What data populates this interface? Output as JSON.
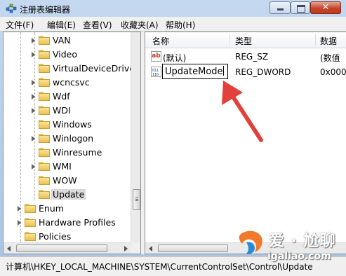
{
  "window": {
    "title": "注册表编辑器",
    "close_glyph": "✕"
  },
  "menu": [
    "文件(F)",
    "编辑(E)",
    "查看(V)",
    "收藏夹(A)",
    "帮助(H)"
  ],
  "tree": {
    "items": [
      {
        "label": "VAN",
        "expandable": true
      },
      {
        "label": "Video",
        "expandable": true
      },
      {
        "label": "VirtualDeviceDriver",
        "expandable": false
      },
      {
        "label": "wcncsvc",
        "expandable": true
      },
      {
        "label": "Wdf",
        "expandable": true
      },
      {
        "label": "WDI",
        "expandable": true
      },
      {
        "label": "Windows",
        "expandable": false
      },
      {
        "label": "Winlogon",
        "expandable": true
      },
      {
        "label": "Winresume",
        "expandable": false
      },
      {
        "label": "WMI",
        "expandable": true
      },
      {
        "label": "WOW",
        "expandable": false
      },
      {
        "label": "Update",
        "expandable": false,
        "selected": true
      },
      {
        "label": "Enum",
        "expandable": true
      },
      {
        "label": "Hardware Profiles",
        "expandable": true
      },
      {
        "label": "Policies",
        "expandable": false
      }
    ]
  },
  "list": {
    "columns": [
      "名称",
      "类型",
      "数据"
    ],
    "rows": [
      {
        "name": "(默认)",
        "type": "REG_SZ",
        "data": "(数值",
        "icon": "string-value-icon"
      },
      {
        "name": "UpdateMode",
        "type": "REG_DWORD",
        "data": "0x000",
        "icon": "dword-value-icon",
        "editing": true
      }
    ],
    "ab_text": "ab",
    "dword_text": "011\n110"
  },
  "status": {
    "path": "计算机\\HKEY_LOCAL_MACHINE\\SYSTEM\\CurrentControlSet\\Control\\Update"
  },
  "watermark": {
    "top": "爱 · 尬聊",
    "bottom": "igaliao.com"
  },
  "colors": {
    "arrow": "#e2413b",
    "selection": "#dadada",
    "close_button": "#c5432b"
  }
}
